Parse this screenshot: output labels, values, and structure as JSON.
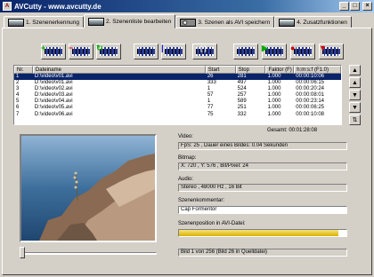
{
  "window": {
    "title": "AVCutty - www.avcutty.de"
  },
  "tabs": [
    {
      "label": "1. Szenenerkennung"
    },
    {
      "label": "2. Szenenliste bearbeiten"
    },
    {
      "label": "3. Szenen als AVI speichern"
    },
    {
      "label": "4. Zusatzfunktionen"
    }
  ],
  "toolbar": {
    "buttons": [
      {
        "icon": "film-add-icon"
      },
      {
        "icon": "film-remove-icon"
      },
      {
        "icon": "film-refresh-icon"
      },
      {
        "icon": "frames-icon"
      },
      {
        "icon": "film-split-icon"
      },
      {
        "icon": "bracket-film-icon"
      },
      {
        "icon": "film-mark-icon"
      },
      {
        "icon": "film-play-icon"
      },
      {
        "icon": "film-record-icon"
      },
      {
        "icon": "film-export-icon"
      }
    ]
  },
  "table": {
    "headers": [
      "Nr.",
      "Dateiname",
      "Start",
      "Stop",
      "Faktor (F)",
      "h:m:s:f (F1.0)"
    ],
    "rows": [
      [
        "1",
        "D:\\video\\v01.avi",
        "26",
        "281",
        "1.000",
        "00:00:10:06"
      ],
      [
        "2",
        "D:\\video\\v01.avi",
        "333",
        "497",
        "1.000",
        "00:00:06:15"
      ],
      [
        "3",
        "D:\\video\\v02.avi",
        "1",
        "524",
        "1.000",
        "00:00:20:24"
      ],
      [
        "4",
        "D:\\video\\v03.avi",
        "57",
        "257",
        "1.000",
        "00:00:08:01"
      ],
      [
        "5",
        "D:\\video\\v04.avi",
        "1",
        "589",
        "1.000",
        "00:00:23:14"
      ],
      [
        "6",
        "D:\\video\\v05.avi",
        "77",
        "251",
        "1.000",
        "00:00:06:25"
      ],
      [
        "7",
        "D:\\video\\v06.avi",
        "75",
        "332",
        "1.000",
        "00:00:10:08"
      ]
    ],
    "selected_row": 0,
    "total_label": "Gesamt: 00:01:28:08"
  },
  "info": {
    "video_label": "Video:",
    "video_value": "FpS: 25 , Dauer eines Bildes: 0.04 Sekunden",
    "bitmap_label": "Bitmap:",
    "bitmap_value": "X: 720 , Y: 576 , Bit/Pixel: 24",
    "audio_label": "Audio:",
    "audio_value": "Stereo , 48000 Hz , 16 Bit",
    "comment_label": "Szenenkommentar:",
    "comment_value": "Cap Formentor",
    "position_label": "Szenenposition in AVI-Datei:",
    "position_fraction": 0.95,
    "status": "Bild 1 von 256 (Bild 26 in Quelldatei)"
  },
  "side_buttons": [
    {
      "icon": "move-up-icon"
    },
    {
      "icon": "arrow-up-icon"
    },
    {
      "icon": "arrow-down-icon"
    },
    {
      "icon": "move-down-icon"
    },
    {
      "icon": "sort-icon"
    }
  ],
  "colors": {
    "selection": "#0a246a",
    "progress": "#d9b200",
    "face": "#d4d0c8"
  }
}
